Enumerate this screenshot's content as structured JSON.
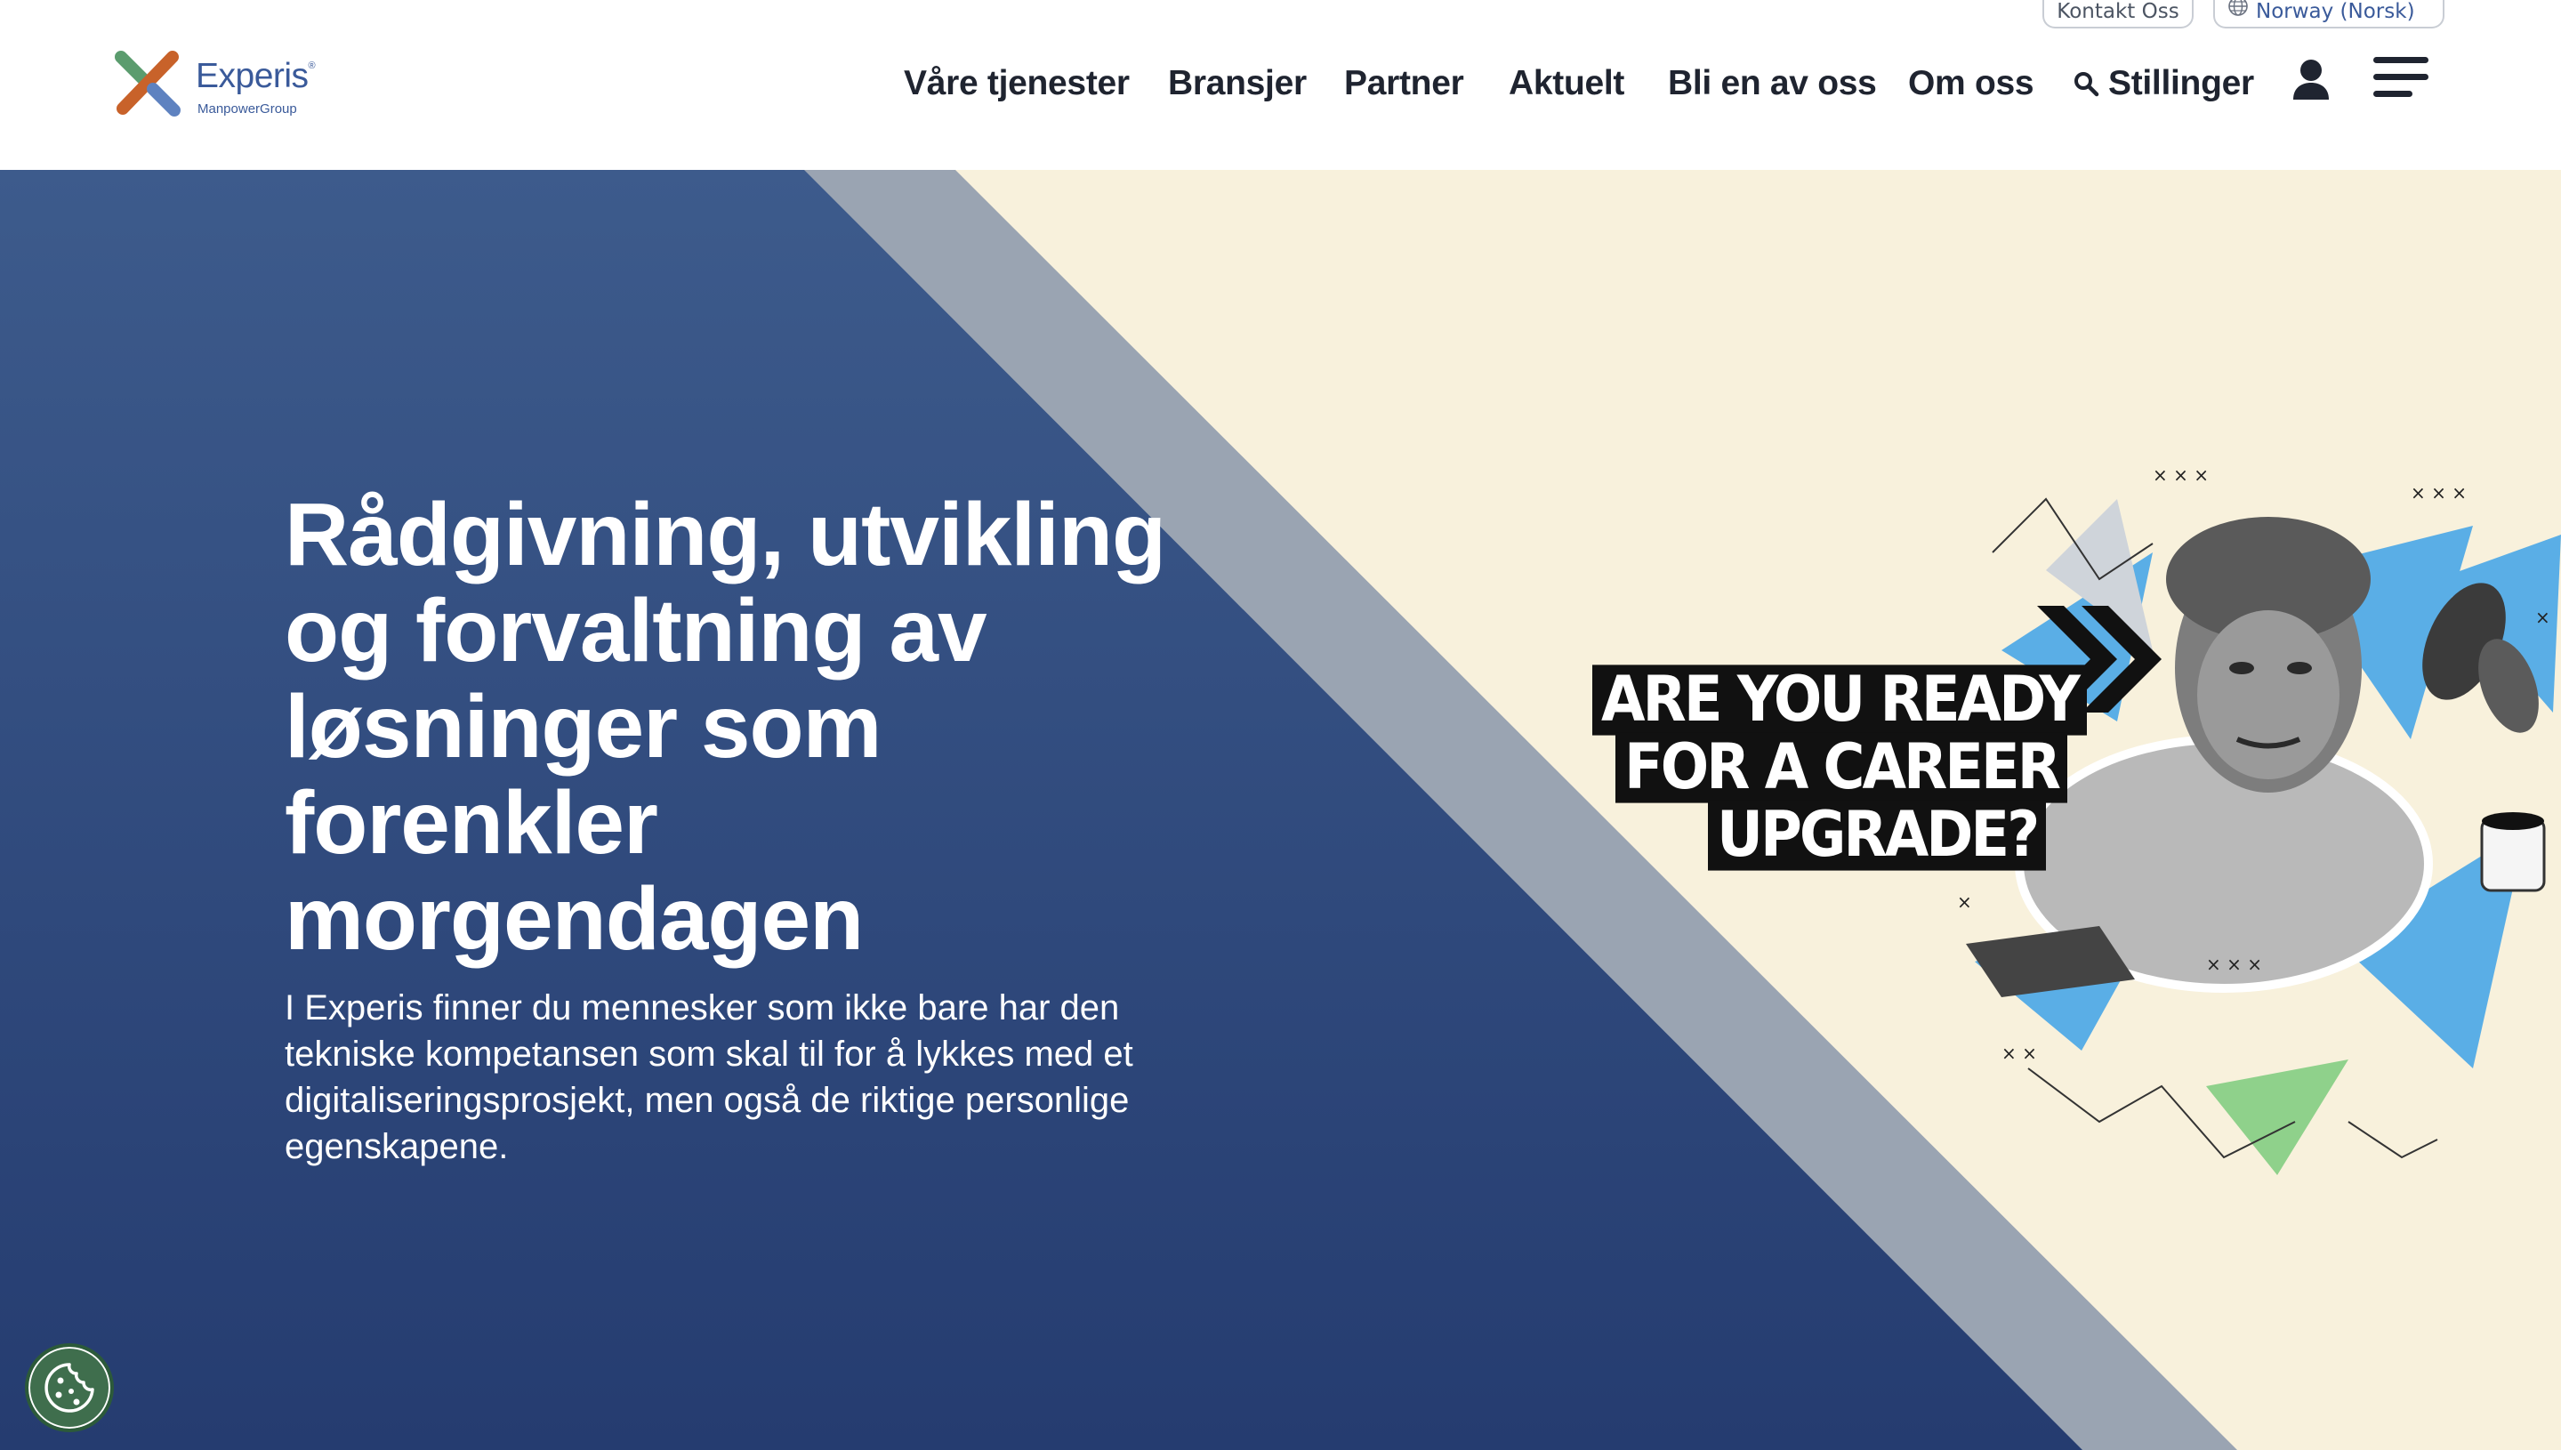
{
  "brand": {
    "name": "Experis",
    "sub": "ManpowerGroup",
    "colors": {
      "x_orange": "#c8622a",
      "x_blue": "#5e82c0",
      "x_green": "#5b9c6e",
      "word": "#3a5a9a"
    }
  },
  "utility": {
    "contact_label": "Kontakt Oss",
    "country_label": "Norway (Norsk)",
    "country_icon": "globe-icon"
  },
  "nav": {
    "items": [
      {
        "label": "Våre tjenester"
      },
      {
        "label": "Bransjer"
      },
      {
        "label": "Partner"
      },
      {
        "label": "Aktuelt"
      },
      {
        "label": "Bli en av oss"
      },
      {
        "label": "Om oss"
      }
    ],
    "search_label": "Stillinger",
    "search_icon": "search-icon",
    "user_icon": "user-icon",
    "menu_icon": "hamburger-menu-icon"
  },
  "hero": {
    "title": "Rådgivning, utvikling og forvaltning av løsninger som forenkler morgendagen",
    "subtitle": "I Experis finner du mennesker som ikke bare har den tekniske kompetansen som skal til for å lykkes med et digitaliseringsprosjekt, men også de riktige personlige egenskapene.",
    "cta_lines": [
      "ARE YOU READY",
      "FOR A CAREER",
      "UPGRADE?"
    ],
    "colors": {
      "blue_top": "#3d5b8c",
      "blue_bottom": "#253c70",
      "stripe": "#9aa4b2",
      "cream": "#f8f1dc"
    }
  },
  "cookie": {
    "icon": "cookie-icon"
  }
}
